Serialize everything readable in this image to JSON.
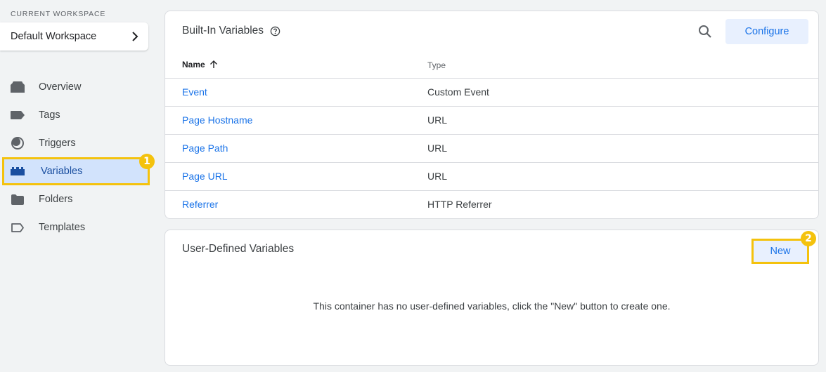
{
  "sidebar": {
    "workspace_label": "CURRENT WORKSPACE",
    "workspace_name": "Default Workspace",
    "items": [
      {
        "label": "Overview",
        "icon": "overview-icon"
      },
      {
        "label": "Tags",
        "icon": "tag-icon"
      },
      {
        "label": "Triggers",
        "icon": "trigger-icon"
      },
      {
        "label": "Variables",
        "icon": "variables-icon",
        "active": true,
        "badge": "1"
      },
      {
        "label": "Folders",
        "icon": "folder-icon"
      },
      {
        "label": "Templates",
        "icon": "template-icon"
      }
    ]
  },
  "builtin": {
    "title": "Built-In Variables",
    "configure_label": "Configure",
    "columns": {
      "name": "Name",
      "type": "Type"
    },
    "rows": [
      {
        "name": "Event",
        "type": "Custom Event"
      },
      {
        "name": "Page Hostname",
        "type": "URL"
      },
      {
        "name": "Page Path",
        "type": "URL"
      },
      {
        "name": "Page URL",
        "type": "URL"
      },
      {
        "name": "Referrer",
        "type": "HTTP Referrer"
      }
    ]
  },
  "userdefined": {
    "title": "User-Defined Variables",
    "new_label": "New",
    "badge": "2",
    "empty_message": "This container has no user-defined variables, click the \"New\" button to create one."
  },
  "colors": {
    "accent": "#1a73e8",
    "highlight": "#f4c20d",
    "active_bg": "#d2e3fc"
  }
}
